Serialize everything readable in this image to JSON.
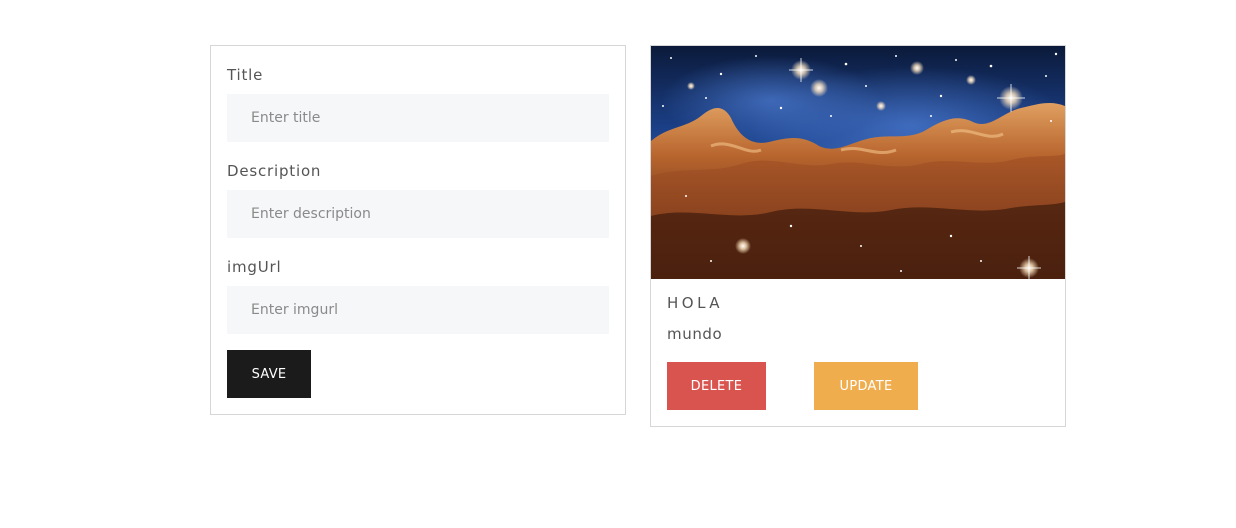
{
  "form": {
    "title_label": "Title",
    "title_placeholder": "Enter title",
    "title_value": "",
    "description_label": "Description",
    "description_placeholder": "Enter description",
    "description_value": "",
    "imgurl_label": "imgUrl",
    "imgurl_placeholder": "Enter imgurl",
    "imgurl_value": "",
    "save_label": "SAVE"
  },
  "post": {
    "image_subject": "nebula-space-photo",
    "title": "HOLA",
    "description": "mundo",
    "delete_label": "DELETE",
    "update_label": "UPDATE"
  },
  "colors": {
    "save_button": "#1b1b1b",
    "delete_button": "#d9534f",
    "update_button": "#f0ad4e",
    "input_background": "#f6f7f9",
    "card_border": "#d6d6d6"
  }
}
